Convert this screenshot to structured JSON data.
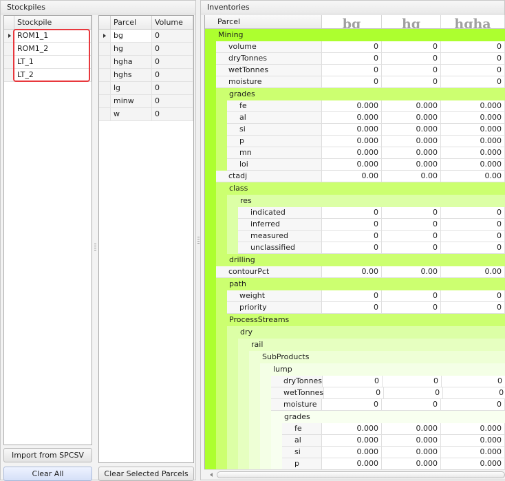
{
  "stockpiles": {
    "title": "Stockpiles",
    "header": "Stockpile",
    "rows": [
      "ROM1_1",
      "ROM1_2",
      "LT_1",
      "LT_2"
    ],
    "import_label": "Import from SPCSV",
    "clear_all_label": "Clear All"
  },
  "parcels": {
    "headers": [
      "Parcel",
      "Volume"
    ],
    "rows": [
      [
        "bg",
        "0"
      ],
      [
        "hg",
        "0"
      ],
      [
        "hgha",
        "0"
      ],
      [
        "hghs",
        "0"
      ],
      [
        "lg",
        "0"
      ],
      [
        "minw",
        "0"
      ],
      [
        "w",
        "0"
      ]
    ],
    "clear_selected_label": "Clear Selected Parcels"
  },
  "inventories": {
    "title": "Inventories",
    "header_label": "Parcel",
    "columns": [
      "bg",
      "hg",
      "hgha"
    ],
    "colors": [
      "#adff2f",
      "#ccff70",
      "#dcffa6",
      "#e6ffc0",
      "#eeffd6",
      "#f4ffe6",
      "#f8fff0"
    ],
    "tree": [
      {
        "g": "Mining",
        "c": [
          {
            "d": "volume",
            "v": [
              "0",
              "0",
              "0"
            ]
          },
          {
            "d": "dryTonnes",
            "v": [
              "0",
              "0",
              "0"
            ]
          },
          {
            "d": "wetTonnes",
            "v": [
              "0",
              "0",
              "0"
            ]
          },
          {
            "d": "moisture",
            "v": [
              "0",
              "0",
              "0"
            ]
          },
          {
            "g": "grades",
            "c": [
              {
                "d": "fe",
                "v": [
                  "0.000",
                  "0.000",
                  "0.000"
                ]
              },
              {
                "d": "al",
                "v": [
                  "0.000",
                  "0.000",
                  "0.000"
                ]
              },
              {
                "d": "si",
                "v": [
                  "0.000",
                  "0.000",
                  "0.000"
                ]
              },
              {
                "d": "p",
                "v": [
                  "0.000",
                  "0.000",
                  "0.000"
                ]
              },
              {
                "d": "mn",
                "v": [
                  "0.000",
                  "0.000",
                  "0.000"
                ]
              },
              {
                "d": "loi",
                "v": [
                  "0.000",
                  "0.000",
                  "0.000"
                ]
              }
            ]
          },
          {
            "d": "ctadj",
            "v": [
              "0.00",
              "0.00",
              "0.00"
            ]
          },
          {
            "g": "class",
            "c": [
              {
                "g": "res",
                "c": [
                  {
                    "d": "indicated",
                    "v": [
                      "0",
                      "0",
                      "0"
                    ]
                  },
                  {
                    "d": "inferred",
                    "v": [
                      "0",
                      "0",
                      "0"
                    ]
                  },
                  {
                    "d": "measured",
                    "v": [
                      "0",
                      "0",
                      "0"
                    ]
                  },
                  {
                    "d": "unclassified",
                    "v": [
                      "0",
                      "0",
                      "0"
                    ]
                  }
                ]
              }
            ]
          },
          {
            "g": "drilling",
            "c": []
          },
          {
            "d": "contourPct",
            "v": [
              "0.00",
              "0.00",
              "0.00"
            ]
          },
          {
            "g": "path",
            "c": [
              {
                "d": "weight",
                "v": [
                  "0",
                  "0",
                  "0"
                ]
              },
              {
                "d": "priority",
                "v": [
                  "0",
                  "0",
                  "0"
                ]
              }
            ]
          },
          {
            "g": "ProcessStreams",
            "c": [
              {
                "g": "dry",
                "c": [
                  {
                    "g": "rail",
                    "c": [
                      {
                        "g": "SubProducts",
                        "c": [
                          {
                            "g": "lump",
                            "c": [
                              {
                                "d": "dryTonnes",
                                "v": [
                                  "0",
                                  "0",
                                  "0"
                                ]
                              },
                              {
                                "d": "wetTonnes",
                                "v": [
                                  "0",
                                  "0",
                                  "0"
                                ]
                              },
                              {
                                "d": "moisture",
                                "v": [
                                  "0",
                                  "0",
                                  "0"
                                ]
                              },
                              {
                                "g": "grades",
                                "c": [
                                  {
                                    "d": "fe",
                                    "v": [
                                      "0.000",
                                      "0.000",
                                      "0.000"
                                    ]
                                  },
                                  {
                                    "d": "al",
                                    "v": [
                                      "0.000",
                                      "0.000",
                                      "0.000"
                                    ]
                                  },
                                  {
                                    "d": "si",
                                    "v": [
                                      "0.000",
                                      "0.000",
                                      "0.000"
                                    ]
                                  },
                                  {
                                    "d": "p",
                                    "v": [
                                      "0.000",
                                      "0.000",
                                      "0.000"
                                    ]
                                  }
                                ]
                              }
                            ]
                          }
                        ]
                      }
                    ]
                  }
                ]
              }
            ]
          }
        ]
      }
    ]
  }
}
